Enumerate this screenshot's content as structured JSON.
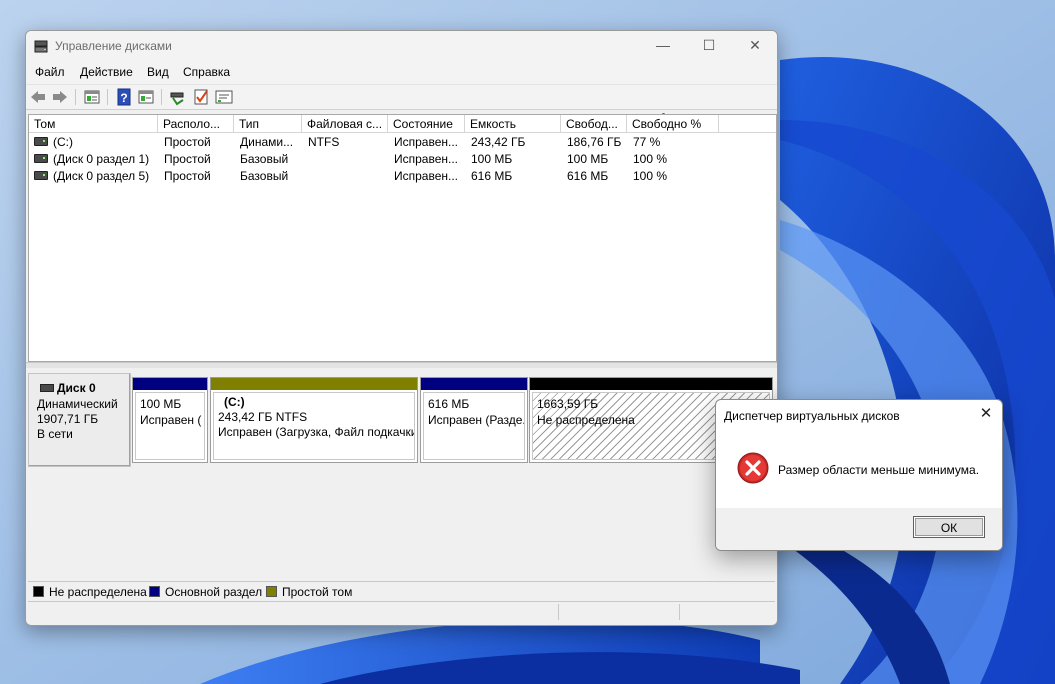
{
  "window": {
    "title": "Управление дисками"
  },
  "menu": [
    "Файл",
    "Действие",
    "Вид",
    "Справка"
  ],
  "toolbar": {
    "icons": [
      "back-icon",
      "forward-icon",
      "properties-icon",
      "help-icon",
      "view-icon",
      "connect-icon",
      "check-icon",
      "console-icon"
    ]
  },
  "volumes": {
    "columns": [
      "Том",
      "Располо...",
      "Тип",
      "Файловая с...",
      "Состояние",
      "Емкость",
      "Свобод...",
      "Свободно %"
    ],
    "rows": [
      [
        "(C:)",
        "Простой",
        "Динами...",
        "NTFS",
        "Исправен...",
        "243,42 ГБ",
        "186,76 ГБ",
        "77 %"
      ],
      [
        "(Диск 0 раздел 1)",
        "Простой",
        "Базовый",
        "",
        "Исправен...",
        "100 МБ",
        "100 МБ",
        "100 %"
      ],
      [
        "(Диск 0 раздел 5)",
        "Простой",
        "Базовый",
        "",
        "Исправен...",
        "616 МБ",
        "616 МБ",
        "100 %"
      ]
    ]
  },
  "disk": {
    "name": "Диск 0",
    "type": "Динамический",
    "size": "1907,71 ГБ",
    "status": "В сети",
    "partitions": [
      {
        "size": "100 МБ",
        "status": "Исправен (",
        "name": ""
      },
      {
        "name": "(C:)",
        "size": "243,42 ГБ NTFS",
        "status": "Исправен (Загрузка, Файл подкачки"
      },
      {
        "size": "616 МБ",
        "status": "Исправен (Разде.",
        "name": ""
      },
      {
        "size": "1663,59 ГБ",
        "status": "Не распределена",
        "name": ""
      }
    ]
  },
  "legend": [
    "Не распределена",
    "Основной раздел",
    "Простой том"
  ],
  "colors": {
    "unallocated": "#000000",
    "primary": "#000080",
    "simple": "#808000"
  },
  "dialog": {
    "title": "Диспетчер виртуальных дисков",
    "message": "Размер области меньше минимума.",
    "ok_label": "ОК"
  }
}
